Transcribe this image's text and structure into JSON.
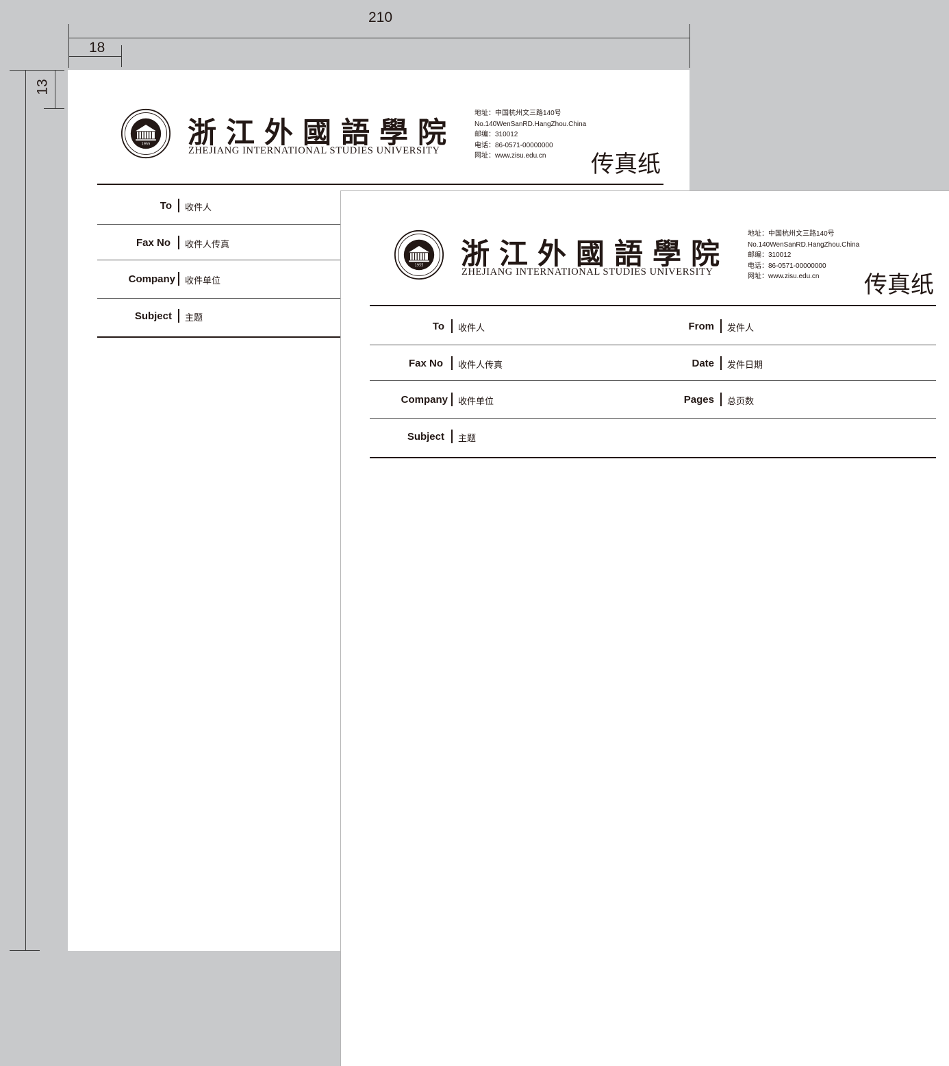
{
  "dimensions": {
    "width_mm": "210",
    "margin_left_mm": "18",
    "margin_top_mm": "13"
  },
  "letterhead": {
    "university_cn": "浙江外國語學院",
    "university_en": "ZHEJIANG INTERNATIONAL STUDIES UNIVERSITY",
    "seal_year": "1955",
    "contact": [
      "地址：中国杭州文三路140号",
      "No.140WenSanRD.HangZhou.China",
      "邮编：310012",
      "电话：86-0571-00000000",
      "网址：www.zisu.edu.cn"
    ],
    "doc_title": "传真纸"
  },
  "fields": {
    "to": {
      "label": "To",
      "value": "收件人"
    },
    "fax_no": {
      "label": "Fax No",
      "value": "收件人传真"
    },
    "company": {
      "label": "Company",
      "value": "收件单位"
    },
    "subject": {
      "label": "Subject",
      "value": "主题"
    },
    "from": {
      "label": "From",
      "value": "发件人"
    },
    "date": {
      "label": "Date",
      "value": "发件日期"
    },
    "pages": {
      "label": "Pages",
      "value": "总页数"
    }
  }
}
